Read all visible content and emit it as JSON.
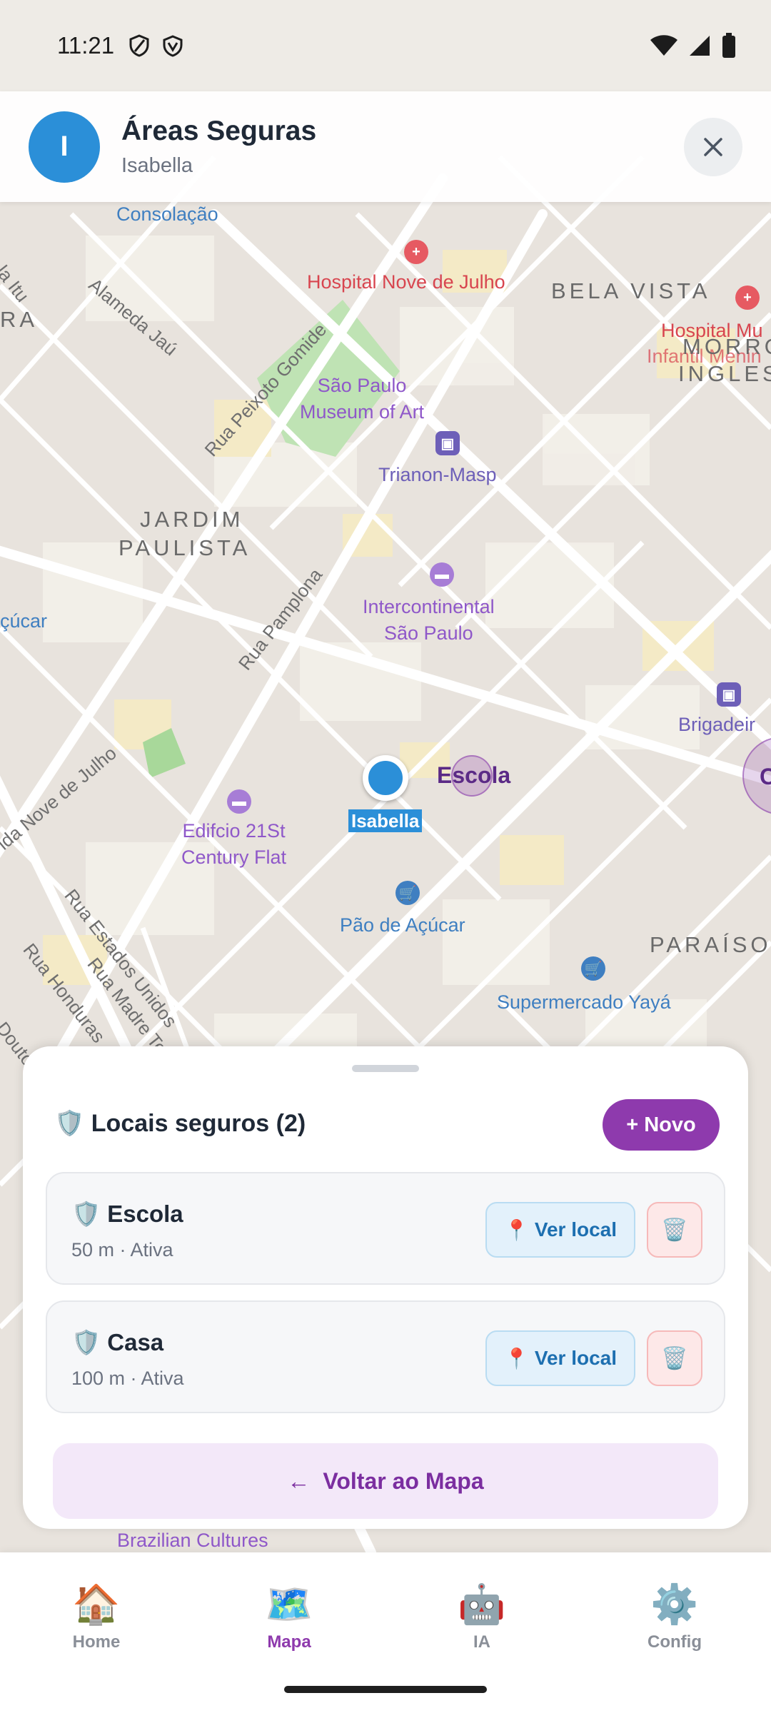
{
  "status_bar": {
    "time": "11:21"
  },
  "header": {
    "avatar_letter": "I",
    "title": "Áreas Seguras",
    "subtitle": "Isabella"
  },
  "map": {
    "labels": {
      "consolacao": "Consolação",
      "hospital": "Hospital Nove de Julho",
      "bela_vista": "BELA VISTA",
      "morro_ingles_1": "MORRO",
      "morro_ingles_2": "INGLES",
      "hospital_right": "Hospital Mu",
      "infantil": "Infantil Menin",
      "alameda_jau": "Alameda Jaú",
      "rua_peixoto": "Rua Peixoto Gomide",
      "museum_1": "São Paulo",
      "museum_2": "Museum of Art",
      "trianon": "Trianon-Masp",
      "jardim_1": "JARDIM",
      "jardim_2": "PAULISTA",
      "intercontinental_1": "Intercontinental",
      "intercontinental_2": "São Paulo",
      "acucar_left": "çúcar",
      "rua_pamplona": "Rua Pamplona",
      "brigadeiro": "Brigadeir",
      "nove_de_julho": "ida Nove de Julho",
      "edificio_1": "Edifcio 21St",
      "edificio_2": "Century Flat",
      "estados_unidos": "Rua Estados Unidos",
      "honduras": "Rua Honduras",
      "madre": "Rua Madre Teodo",
      "pao_acucar": "Pão de Açúcar",
      "paraiso": "PARAÍSO",
      "supermercado": "Supermercado Yayá",
      "brazilian": "Brazilian Cultures",
      "ra": "RA",
      "itu": "la Itu",
      "doutor": "Doutor"
    },
    "marker_label": "Isabella",
    "zone_label": "Escola",
    "zone_label_2": "C"
  },
  "sheet": {
    "title": "🛡️ Locais seguros (2)",
    "new_button": "+ Novo",
    "places": [
      {
        "icon": "🛡️",
        "name": "Escola",
        "meta": "50 m · Ativa",
        "view_label": "Ver local"
      },
      {
        "icon": "🛡️",
        "name": "Casa",
        "meta": "100 m · Ativa",
        "view_label": "Ver local"
      }
    ],
    "back_button": "Voltar ao Mapa",
    "back_arrow": "←"
  },
  "nav": {
    "items": [
      {
        "label": "Home",
        "icon": "🏠"
      },
      {
        "label": "Mapa",
        "icon": "🗺️"
      },
      {
        "label": "IA",
        "icon": "🤖"
      },
      {
        "label": "Config",
        "icon": "⚙️"
      }
    ],
    "active": "Mapa"
  },
  "colors": {
    "accent": "#8e3aad",
    "user_blue": "#2b8fd8"
  }
}
